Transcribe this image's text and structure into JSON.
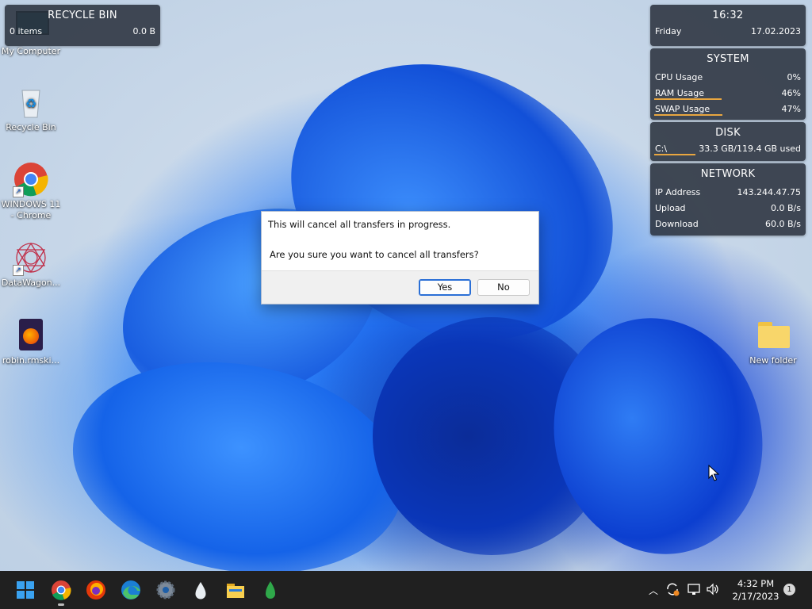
{
  "desktop": {
    "icons": [
      {
        "label": "My Computer"
      },
      {
        "label": "Recycle Bin"
      },
      {
        "label": "WINDOWS 11 - Chrome"
      },
      {
        "label": "DataWagon..."
      },
      {
        "label": "robin.rmski..."
      },
      {
        "label": "New folder"
      }
    ]
  },
  "recycle_widget": {
    "title": "RECYCLE BIN",
    "items": "0 items",
    "size": "0.0 B"
  },
  "clock_widget": {
    "time": "16:32",
    "day": "Friday",
    "date": "17.02.2023"
  },
  "system_widget": {
    "title": "SYSTEM",
    "rows": [
      {
        "label": "CPU Usage",
        "value": "0%",
        "percent": 0
      },
      {
        "label": "RAM Usage",
        "value": "46%",
        "percent": 46
      },
      {
        "label": "SWAP Usage",
        "value": "47%",
        "percent": 47
      }
    ]
  },
  "disk_widget": {
    "title": "DISK",
    "drive": "C:\\",
    "usage": "33.3 GB/119.4 GB used",
    "percent": 28
  },
  "network_widget": {
    "title": "NETWORK",
    "rows": [
      {
        "label": "IP Address",
        "value": "143.244.47.75"
      },
      {
        "label": "Upload",
        "value": "0.0 B/s"
      },
      {
        "label": "Download",
        "value": "60.0 B/s"
      }
    ]
  },
  "dialog": {
    "message_line1": "This will cancel all transfers in progress.",
    "message_line2": "Are you sure you want to cancel all transfers?",
    "yes_label": "Yes",
    "no_label": "No"
  },
  "taskbar": {
    "apps": [
      "start-icon",
      "chrome-icon",
      "firefox-icon",
      "edge-icon",
      "settings-icon",
      "inkscape-icon",
      "file-explorer-icon",
      "drop-icon"
    ],
    "time": "4:32 PM",
    "date": "2/17/2023",
    "notification_count": "1"
  },
  "colors": {
    "accent": "#2a6fd6",
    "widget_bg": "#282e3a",
    "bar": "#e8a640",
    "taskbar": "#202020"
  }
}
